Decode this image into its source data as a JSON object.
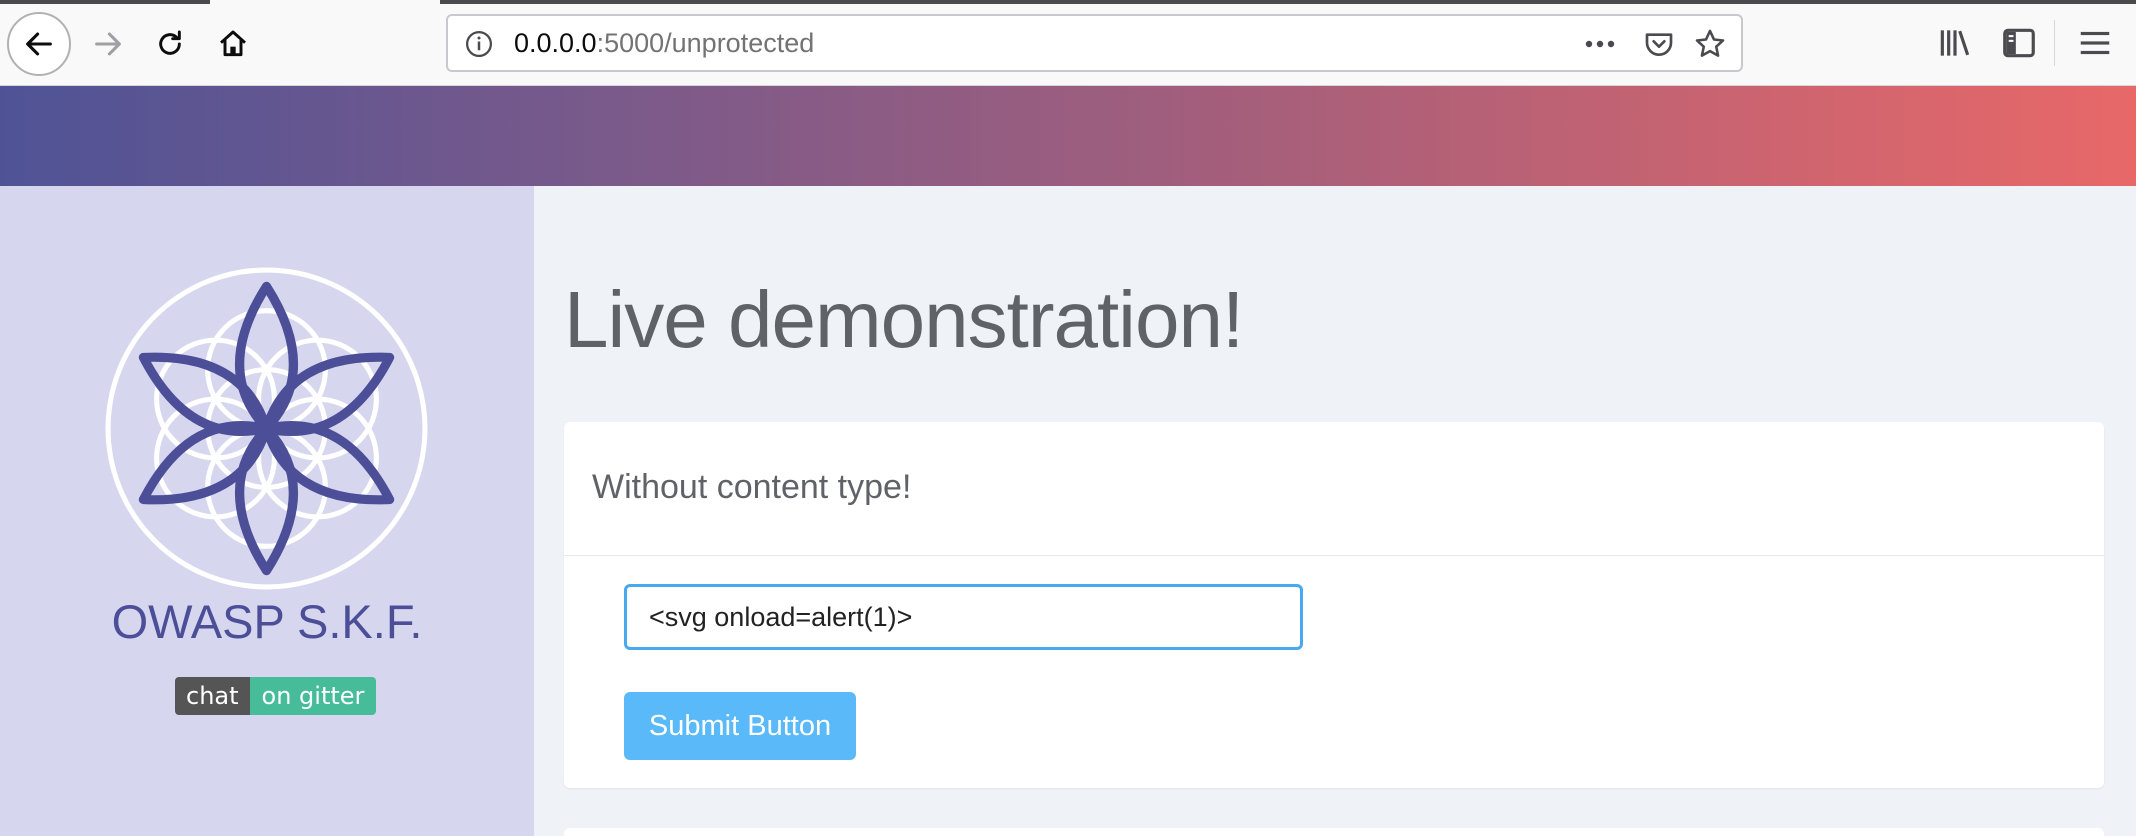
{
  "browser": {
    "url_host": "0.0.0.0",
    "url_rest": ":5000/unprotected",
    "icons": [
      "back-icon",
      "forward-icon",
      "reload-icon",
      "home-icon",
      "info-icon",
      "more-icon",
      "pocket-icon",
      "star-icon",
      "library-icon",
      "sidebar-icon",
      "menu-icon"
    ]
  },
  "sidebar": {
    "brand": "OWASP S.K.F.",
    "badge_left": "chat",
    "badge_right": "on gitter"
  },
  "main": {
    "title": "Live demonstration!",
    "card_title": "Without content type!",
    "input_value": "<svg onload=alert(1)>",
    "submit_label": "Submit Button"
  },
  "colors": {
    "accent": "#4c4f98",
    "button": "#5ab9f8",
    "input_border": "#4aa8ef",
    "gitter": "#46bc99",
    "gradient_start": "#4f5396",
    "gradient_end": "#e86868"
  }
}
